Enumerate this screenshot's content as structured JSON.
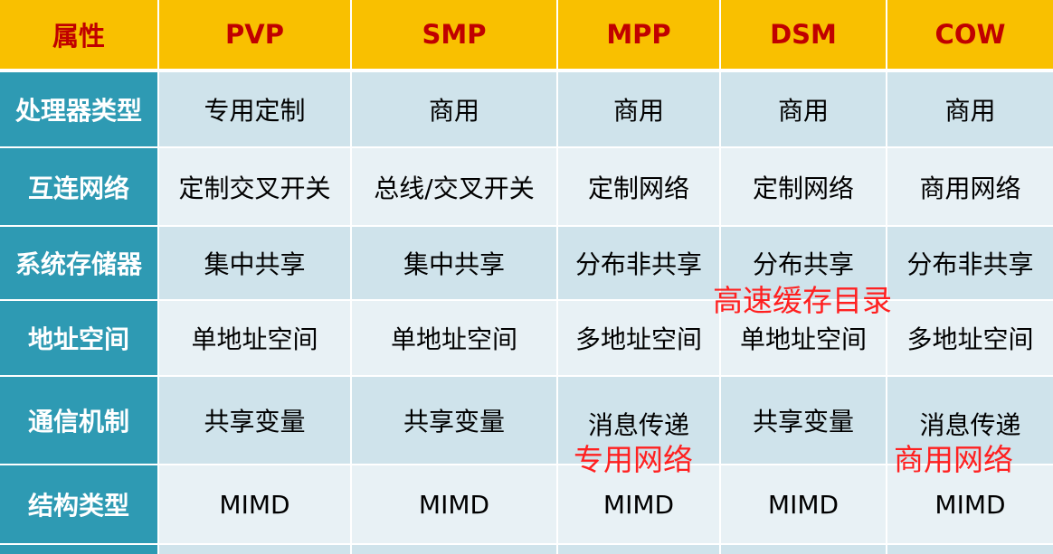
{
  "header": [
    "属性",
    "PVP",
    "SMP",
    "MPP",
    "DSM",
    "COW"
  ],
  "rows": [
    {
      "label": "处理器类型",
      "values": [
        "专用定制",
        "商用",
        "商用",
        "商用",
        "商用"
      ]
    },
    {
      "label": "互连网络",
      "values": [
        "定制交叉开关",
        "总线/交叉开关",
        "定制网络",
        "定制网络",
        "商用网络"
      ]
    },
    {
      "label": "系统存储器",
      "values": [
        "集中共享",
        "集中共享",
        "分布非共享",
        "分布共享",
        "分布非共享"
      ]
    },
    {
      "label": "地址空间",
      "values": [
        "单地址空间",
        "单地址空间",
        "多地址空间",
        "单地址空间",
        "多地址空间"
      ]
    },
    {
      "label": "通信机制",
      "values": [
        "共享变量",
        "共享变量",
        "消息传递",
        "共享变量",
        "消息传递"
      ]
    },
    {
      "label": "结构类型",
      "values": [
        "MIMD",
        "MIMD",
        "MIMD",
        "MIMD",
        "MIMD"
      ]
    }
  ],
  "annotations": {
    "dsm_storage": "高速缓存目录",
    "mpp_network": "专用网络",
    "cow_network": "商用网络"
  }
}
